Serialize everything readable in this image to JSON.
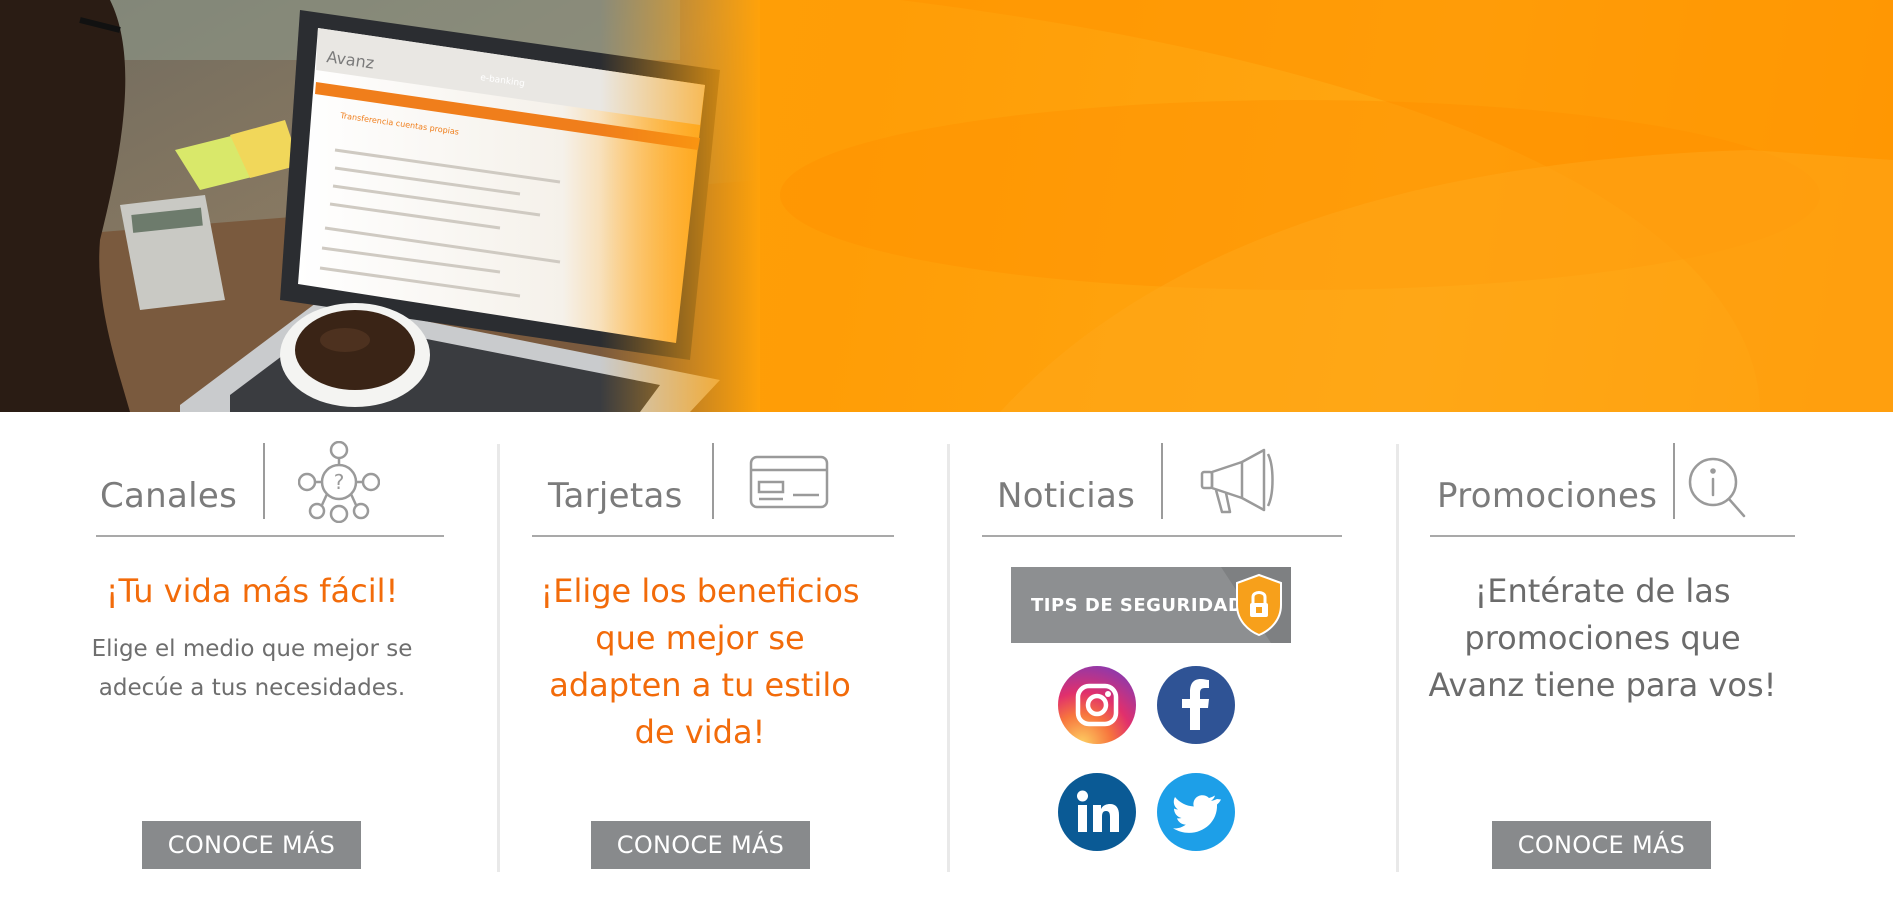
{
  "hero": {
    "screen_logo": "Avanz",
    "screen_title": "e-banking",
    "screen_heading": "Transferencia cuentas propias"
  },
  "columns": [
    {
      "title": "Canales",
      "icon": "network-question-icon",
      "headline": "¡Tu vida más fácil!",
      "description": "Elige el medio que mejor se adecúe a tus necesidades.",
      "button": "CONOCE MÁS"
    },
    {
      "title": "Tarjetas",
      "icon": "credit-card-icon",
      "headline": "¡Elige los beneficios que mejor se adapten a tu estilo de vida!",
      "button": "CONOCE MÁS"
    },
    {
      "title": "Noticias",
      "icon": "megaphone-icon",
      "tips_label": "TIPS DE SEGURIDAD",
      "social": [
        "instagram-icon",
        "facebook-icon",
        "linkedin-icon",
        "twitter-icon"
      ]
    },
    {
      "title": "Promociones",
      "icon": "info-search-icon",
      "headline": "¡Entérate de las promociones que Avanz tiene para vos!",
      "button": "CONOCE MÁS"
    }
  ],
  "colors": {
    "accent": "#f26b0a",
    "hero_orange": "#ffa20a",
    "button_gray": "#888a8c",
    "facebook": "#3b5998",
    "linkedin": "#0e76a8",
    "twitter": "#1da1f2"
  }
}
